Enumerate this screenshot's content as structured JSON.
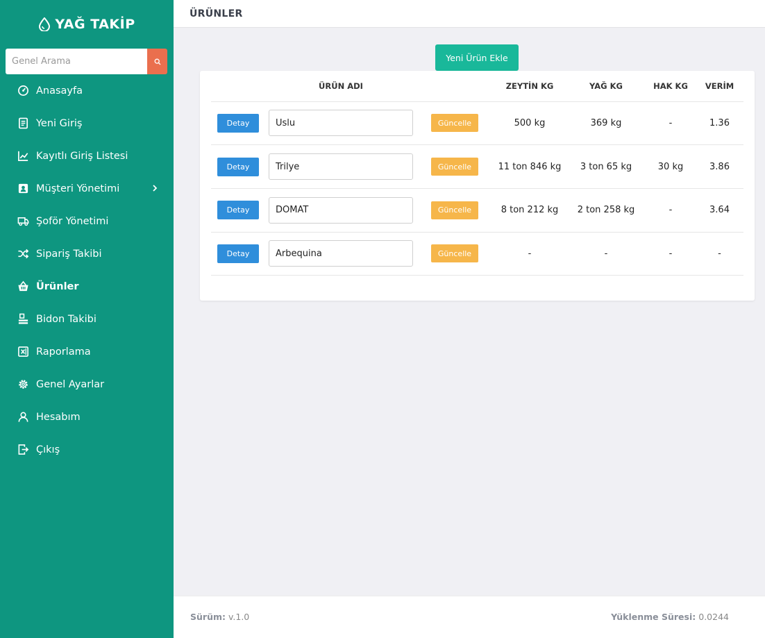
{
  "brand": {
    "name": "YAĞ TAKİP"
  },
  "search": {
    "placeholder": "Genel Arama"
  },
  "nav": {
    "items": [
      {
        "label": "Anasayfa",
        "icon": "dashboard-icon"
      },
      {
        "label": "Yeni Giriş",
        "icon": "document-icon"
      },
      {
        "label": "Kayıtlı Giriş Listesi",
        "icon": "chart-line-icon"
      },
      {
        "label": "Müşteri Yönetimi",
        "icon": "contact-icon"
      },
      {
        "label": "Şoför Yönetimi",
        "icon": "truck-icon"
      },
      {
        "label": "Sipariş Takibi",
        "icon": "shuffle-icon"
      },
      {
        "label": "Ürünler",
        "icon": "basket-icon"
      },
      {
        "label": "Bidon Takibi",
        "icon": "stack-icon"
      },
      {
        "label": "Raporlama",
        "icon": "excel-icon"
      },
      {
        "label": "Genel Ayarlar",
        "icon": "gear-icon"
      },
      {
        "label": "Hesabım",
        "icon": "user-icon"
      },
      {
        "label": "Çıkış",
        "icon": "logout-icon"
      }
    ],
    "active": "Ürünler"
  },
  "header": {
    "title": "ÜRÜNLER"
  },
  "actions": {
    "add_label": "Yeni Ürün Ekle"
  },
  "table": {
    "columns": {
      "blank1": "",
      "name": "ÜRÜN ADI",
      "blank2": "",
      "olive": "ZEYTİN KG",
      "oil": "YAĞ KG",
      "hak": "HAK KG",
      "yield": "VERİM"
    },
    "detail_label": "Detay",
    "update_label": "Güncelle",
    "rows": [
      {
        "name": "Uslu",
        "olive": "500 kg",
        "oil": "369 kg",
        "hak": "-",
        "yield": "1.36"
      },
      {
        "name": "Trilye",
        "olive": "11 ton 846 kg",
        "oil": "3 ton 65 kg",
        "hak": "30 kg",
        "yield": "3.86"
      },
      {
        "name": "DOMAT",
        "olive": "8 ton 212 kg",
        "oil": "2 ton 258 kg",
        "hak": "-",
        "yield": "3.64"
      },
      {
        "name": "Arbequina",
        "olive": "-",
        "oil": "-",
        "hak": "-",
        "yield": "-"
      }
    ]
  },
  "footer": {
    "version_label": "Sürüm:",
    "version_value": "v.1.0",
    "load_label": "Yüklenme Süresi:",
    "load_value": "0.0244"
  },
  "colors": {
    "sidebar": "#0e9680",
    "primary": "#19b89a",
    "detail": "#2f8edb",
    "update": "#f6b64a",
    "search_button": "#ea6f4e"
  }
}
